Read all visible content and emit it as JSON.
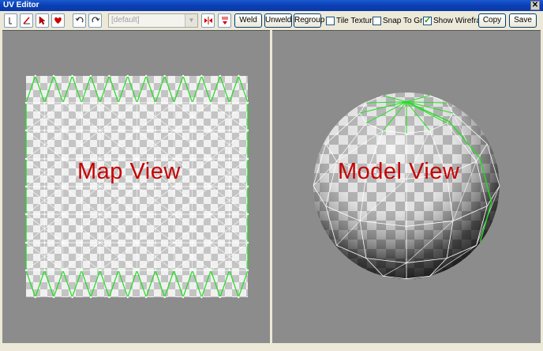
{
  "window": {
    "title": "UV Editor",
    "close_glyph": "✕"
  },
  "toolbar": {
    "tool_icons": [
      "pointer-icon",
      "paint-brush-icon",
      "select-arrow-icon",
      "heart-select-icon"
    ],
    "undo_icon": "undo-icon",
    "redo_icon": "redo-icon",
    "dropdown_value": "[default]",
    "flip_icon": "mirror-h-icon",
    "rotate_icon": "rotate-90-icon",
    "weld_label": "Weld",
    "unweld_label": "Unweld",
    "regroup_label": "Regroup",
    "tile_texture_label": "Tile Texture",
    "tile_texture_checked": false,
    "snap_to_grid_label": "Snap To Grid",
    "snap_to_grid_checked": false,
    "show_wireframe_label": "Show Wireframe",
    "show_wireframe_checked": true,
    "copy_label": "Copy",
    "save_label": "Save"
  },
  "views": {
    "map_label": "Map View",
    "model_label": "Model View"
  },
  "colors": {
    "accent_red": "#c80000",
    "seam_green": "#22dd22",
    "viewport_bg": "#8c8c8c"
  }
}
